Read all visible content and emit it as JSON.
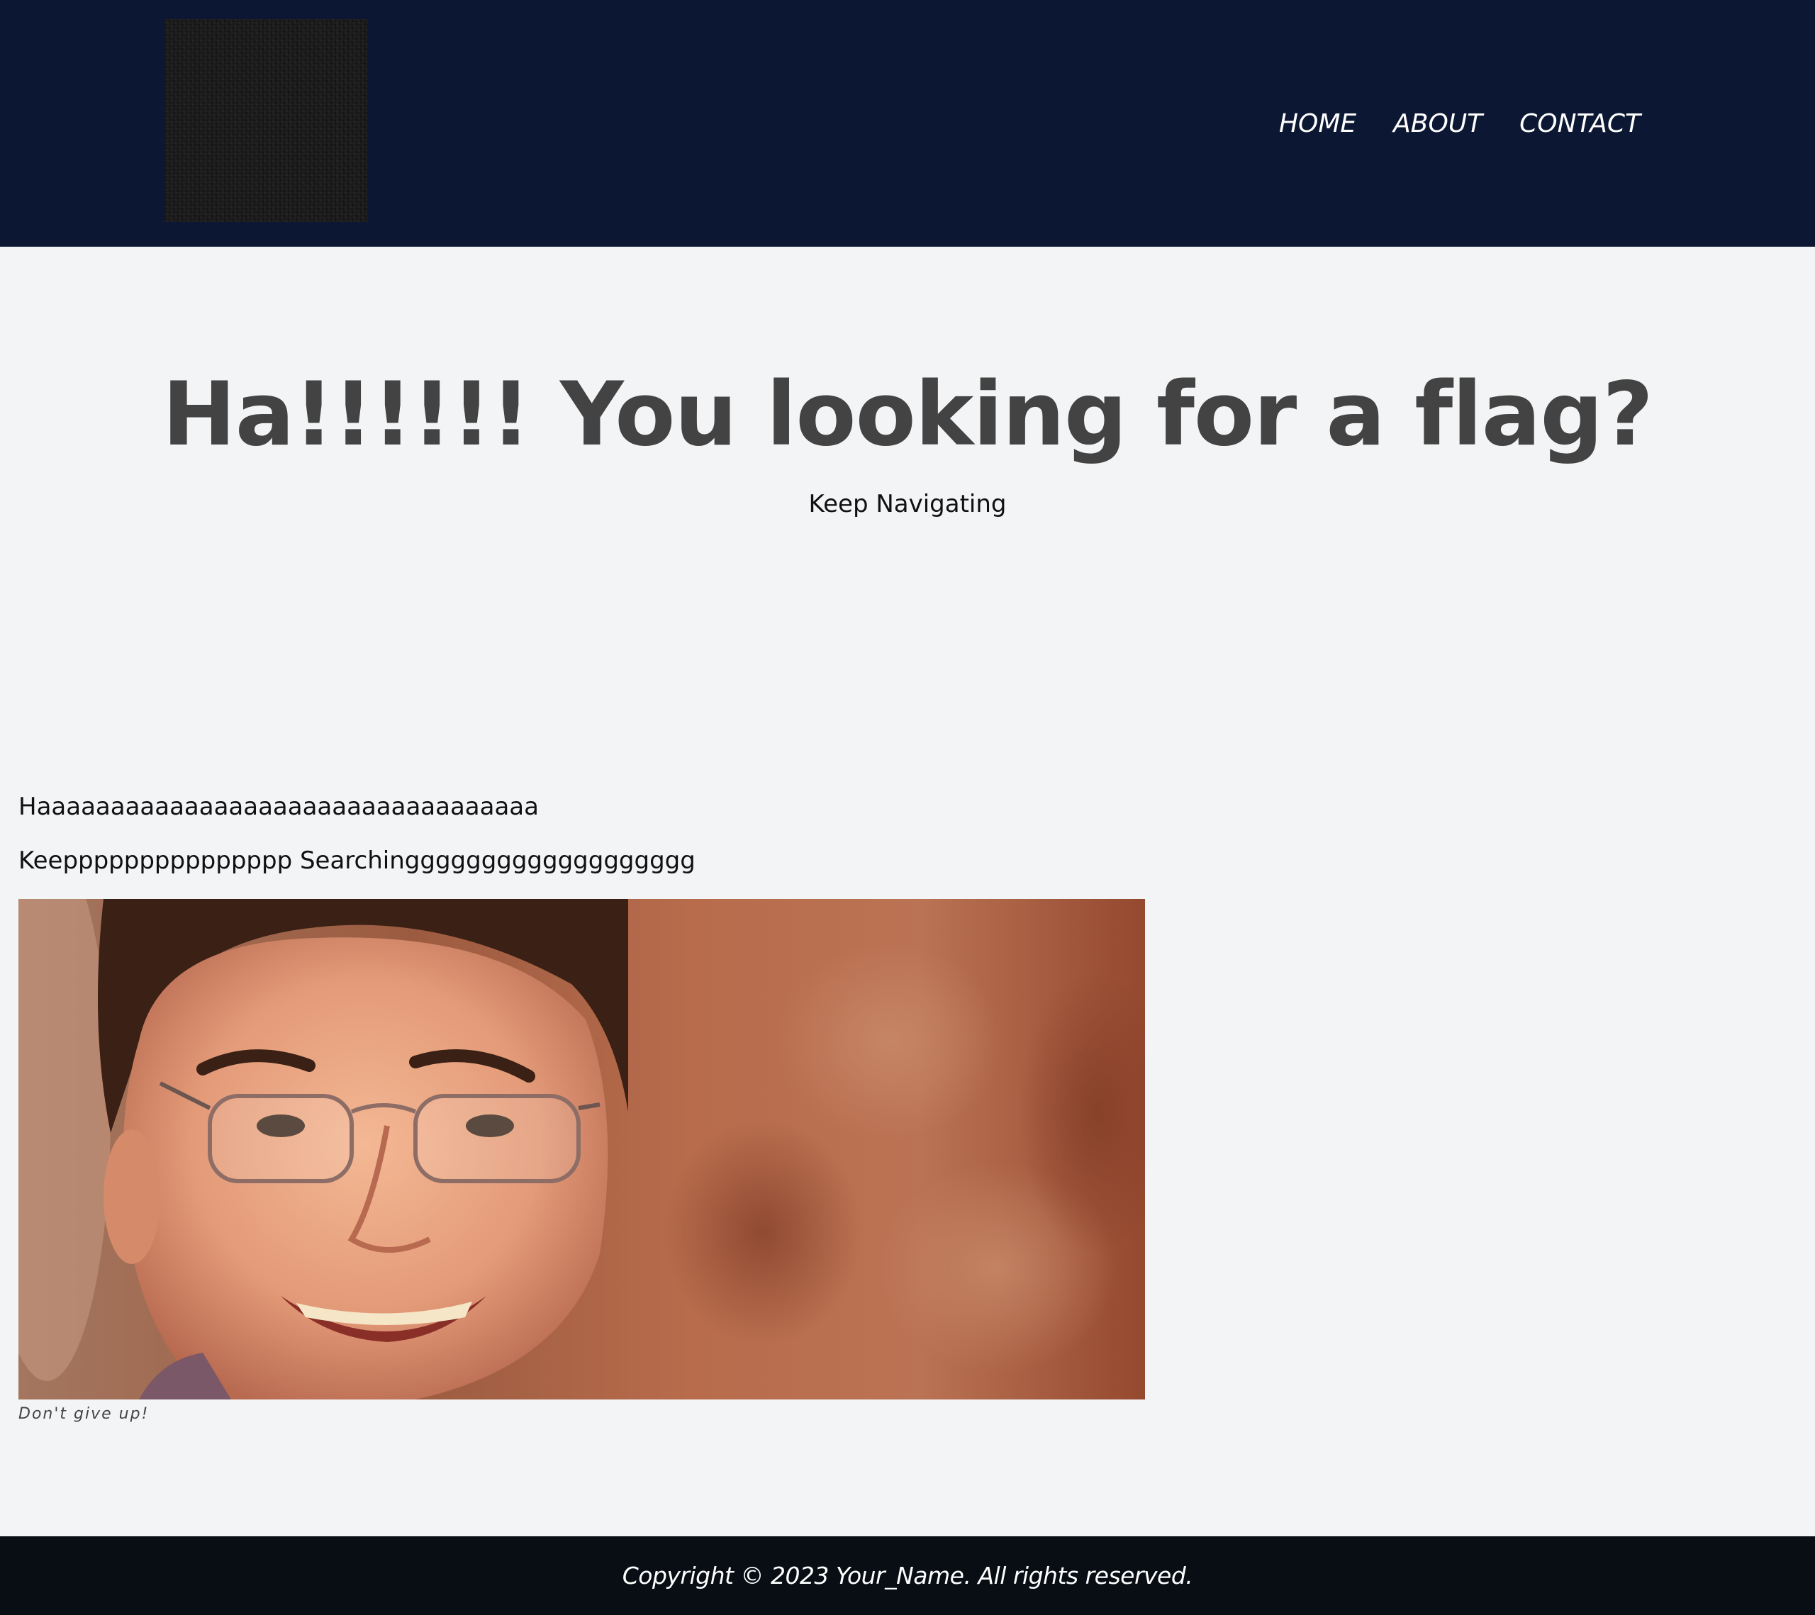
{
  "header": {
    "nav": {
      "home": "HOME",
      "about": "ABOUT",
      "contact": "CONTACT"
    }
  },
  "hero": {
    "title": "Ha!!!!!! You looking for a flag?",
    "subtitle": "Keep Navigating"
  },
  "content": {
    "paragraph_1": "Haaaaaaaaaaaaaaaaaaaaaaaaaaaaaaaaaa",
    "paragraph_2": "Keeppppppppppppppp Searchinggggggggggggggggggg",
    "image_caption": "Don't give up!"
  },
  "footer": {
    "copyright": "Copyright © 2023 Your_Name. All rights reserved."
  },
  "colors": {
    "header_bg": "#0c1833",
    "page_bg": "#f3f4f6",
    "footer_bg": "#080e14",
    "heading_text": "#434343"
  }
}
